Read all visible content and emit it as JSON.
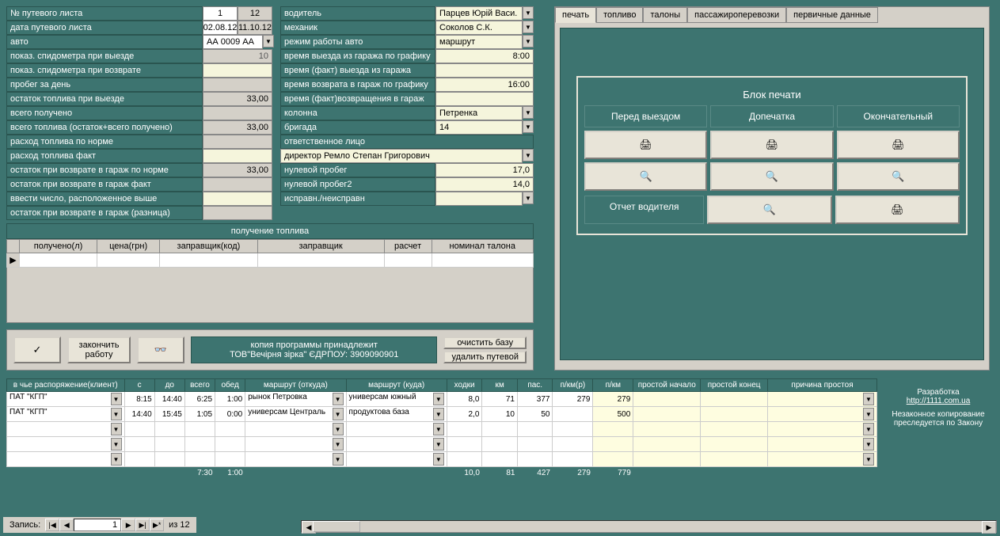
{
  "left_labels": [
    "№ путевого листа",
    "дата путевого листа",
    "авто",
    "показ. спидометра при выезде",
    "показ. спидометра при возврате",
    "пробег за день",
    "остаток топлива при выезде",
    "всего получено",
    "всего топлива (остаток+всего получено)",
    "расход топлива по норме",
    "расход топлива факт",
    "остаток при возврате в гараж по норме",
    "остаток при возврате в гараж  факт",
    "ввести число, расположенное выше",
    "остаток при возврате в гараж (разница)"
  ],
  "left_values": {
    "num1": "1",
    "num2": "12",
    "date1": "02.08.12",
    "date2": "11.10.12",
    "auto": "АА 0009 АА",
    "spido_out": "10",
    "probeg": "",
    "fuel_out": "33,00",
    "poluch": "",
    "total_fuel": "33,00",
    "norma": "",
    "fakt": "",
    "ost_norma": "33,00",
    "ost_fakt": "",
    "vvesti": "",
    "razn": ""
  },
  "right_labels": [
    "водитель",
    "механик",
    "режим работы авто",
    "время выезда из гаража по графику",
    "время (факт) выезда из гаража",
    "время возврата в гараж по графику",
    "время (факт)возвращения в гараж",
    "колонна",
    "бригада",
    "ответственное лицо",
    "",
    "нулевой пробег",
    "нулевой пробег2",
    "исправн./неисправн"
  ],
  "right_values": {
    "driver": "Парцев Юрій Васи.",
    "mechanic": "Соколов С.К.",
    "mode": "маршрут",
    "out_plan": "8:00",
    "out_fact": "",
    "in_plan": "16:00",
    "in_fact": "",
    "kolonna": "Петренка",
    "brigada": "14",
    "resp_person": "директор Ремло Степан Григорович",
    "nul1": "17,0",
    "nul2": "14,0",
    "isprav": ""
  },
  "fuel_section": {
    "title": "получение топлива",
    "cols": [
      "получено(л)",
      "цена(грн)",
      "заправщик(код)",
      "заправщик",
      "расчет",
      "номинал талона"
    ]
  },
  "buttons": {
    "finish": "закончить\nработу",
    "clear_db": "очистить базу",
    "delete": "удалить путевой"
  },
  "copyright": {
    "line1": "копия программы принадлежит",
    "line2": "ТОВ\"Вечірня зірка\"     ЄДРПОУ: 3909090901"
  },
  "tabs": [
    "печать",
    "топливо",
    "талоны",
    "пассажироперевозки",
    "первичные данные"
  ],
  "print_block": {
    "title": "Блок печати",
    "headers": [
      "Перед выездом",
      "Допечатка",
      "Окончательный"
    ],
    "report": "Отчет водителя"
  },
  "bottom": {
    "cols": [
      "в чье распоряжение(клиент)",
      "с",
      "до",
      "всего",
      "обед",
      "маршрут (откуда)",
      "маршрут (куда)",
      "ходки",
      "км",
      "пас.",
      "п/км(р)",
      "п/км",
      "простой начало",
      "простой конец",
      "причина простоя"
    ],
    "rows": [
      {
        "client": "ПАТ \"КГП\"",
        "from": "8:15",
        "to": "14:40",
        "total": "6:25",
        "obed": "1:00",
        "r_from": "рынок Петровка",
        "r_to": "универсам южный",
        "hodki": "8,0",
        "km": "71",
        "pas": "377",
        "pkmr": "279",
        "pkm": "279",
        "ps": "",
        "pe": "",
        "reason": ""
      },
      {
        "client": "ПАТ \"КГП\"",
        "from": "14:40",
        "to": "15:45",
        "total": "1:05",
        "obed": "0:00",
        "r_from": "универсам Централь",
        "r_to": "продуктова база",
        "hodki": "2,0",
        "km": "10",
        "pas": "50",
        "pkmr": "",
        "pkm": "500",
        "ps": "",
        "pe": "",
        "reason": ""
      }
    ],
    "totals": {
      "total": "7:30",
      "obed": "1:00",
      "hodki": "10,0",
      "km": "81",
      "pas": "427",
      "pkmr": "279",
      "pkm": "779"
    }
  },
  "credits": {
    "dev": "Разработка",
    "link": "http://1111.com.ua",
    "warn": "Незаконное копирование преследуется по Закону"
  },
  "nav": {
    "label": "Запись:",
    "cur": "1",
    "of": "из  12"
  }
}
